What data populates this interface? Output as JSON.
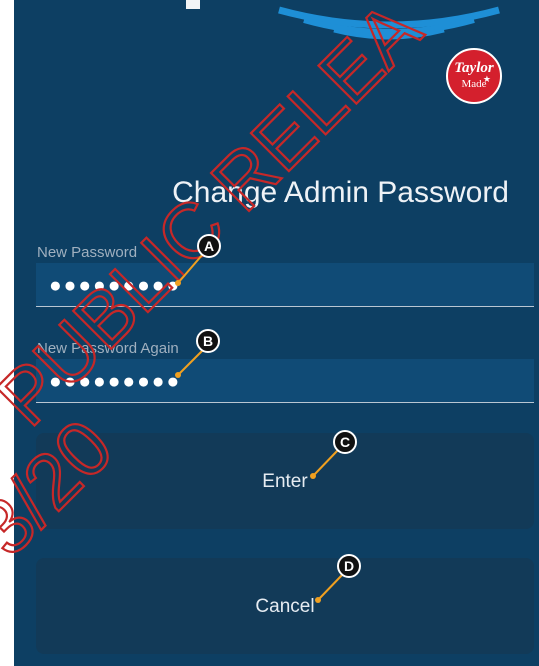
{
  "header": {
    "logo_line1": "Taylor",
    "logo_line2": "Made",
    "logo_star": "★"
  },
  "page": {
    "title": "Change Admin Password"
  },
  "form": {
    "new_password_label": "New Password",
    "new_password_value": "●●●●●●●●●",
    "new_password_again_label": "New Password Again",
    "new_password_again_value": "●●●●●●●●●"
  },
  "buttons": {
    "enter_label": "Enter",
    "cancel_label": "Cancel"
  },
  "callouts": {
    "a": "A",
    "b": "B",
    "c": "C",
    "d": "D"
  },
  "watermark": {
    "text": "PUBLIC RELEA",
    "date_text": "3/20"
  },
  "colors": {
    "background": "#0d3f63",
    "field": "#104b76",
    "button": "#123a58",
    "logo_red": "#d4202d",
    "callout_line": "#f0a020",
    "watermark": "#c62828"
  }
}
